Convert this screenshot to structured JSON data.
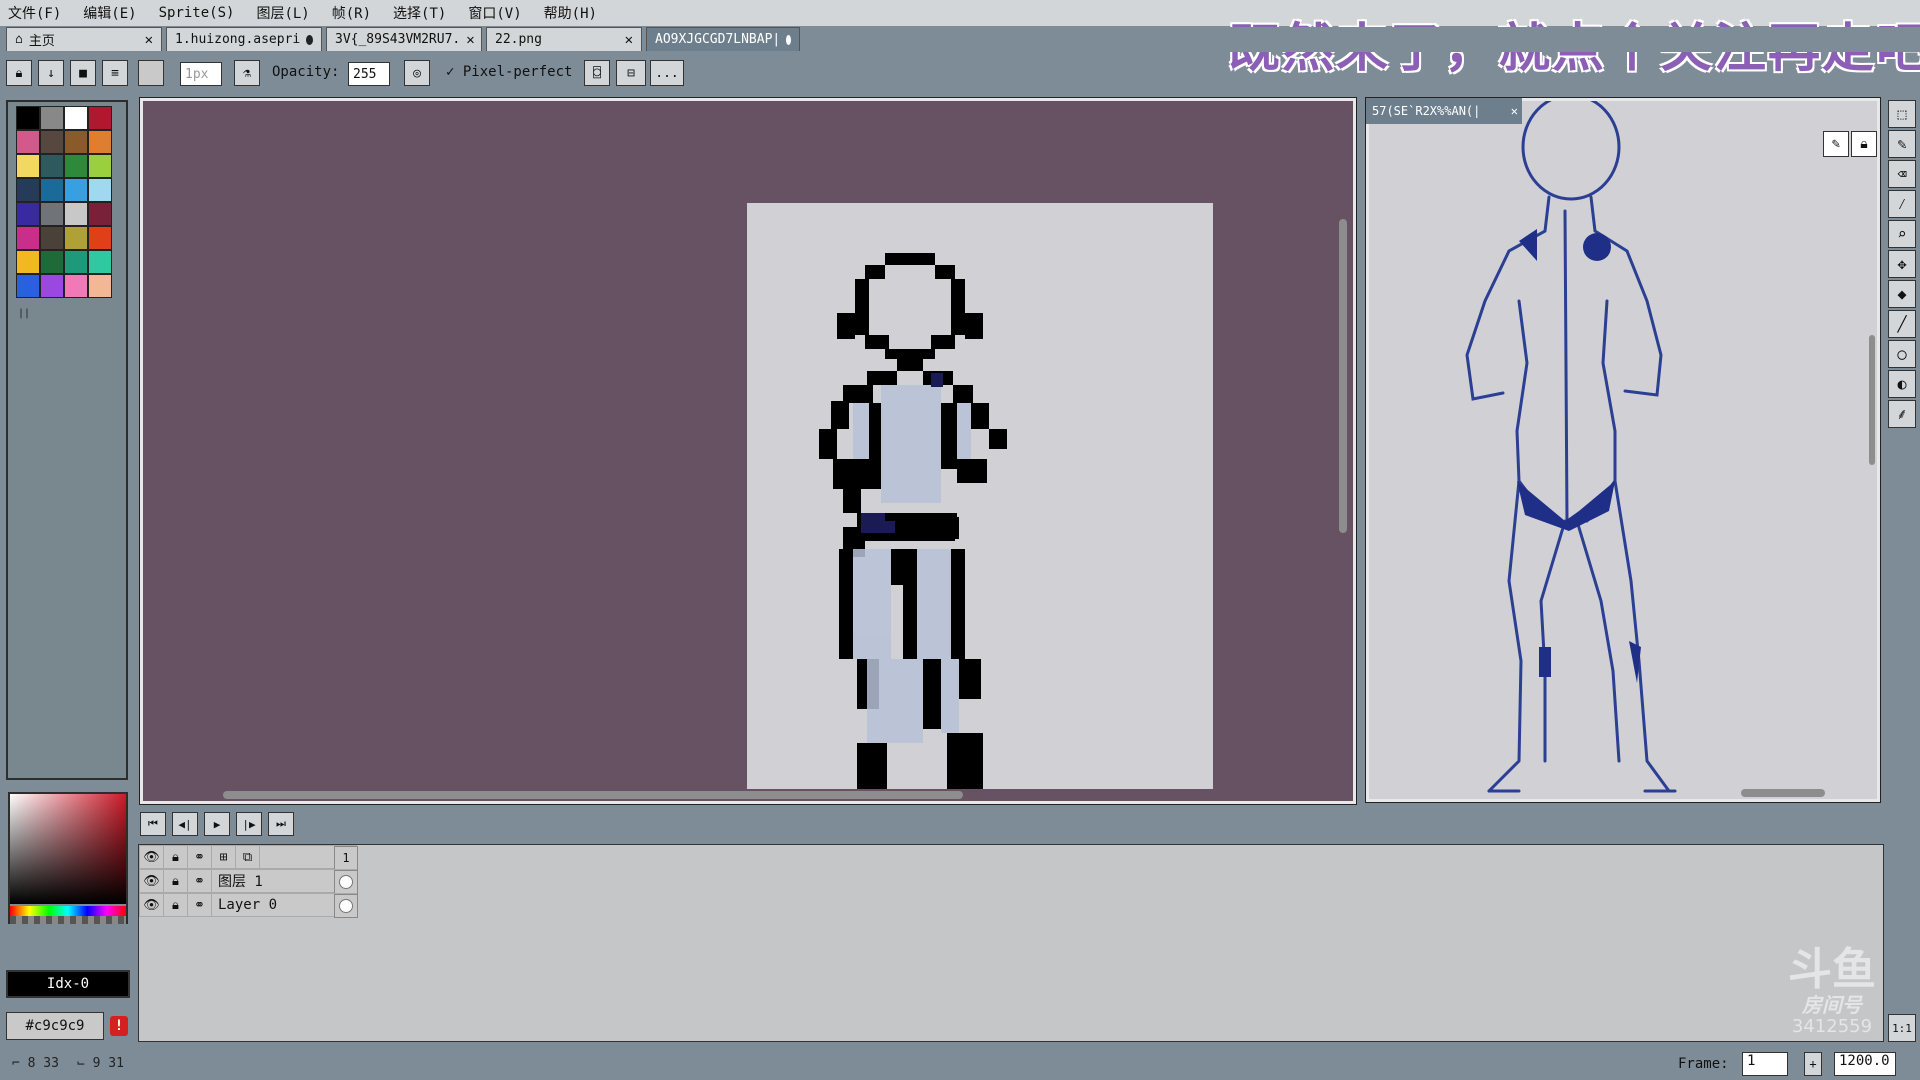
{
  "menu": [
    "文件(F)",
    "编辑(E)",
    "Sprite(S)",
    "图层(L)",
    "帧(R)",
    "选择(T)",
    "窗口(V)",
    "帮助(H)"
  ],
  "promo_text": "既然来了，就点个关注再走吧！",
  "tabs": [
    {
      "label": "主页",
      "state": "close"
    },
    {
      "label": "1.huizong.asepri",
      "state": "dirty"
    },
    {
      "label": "3V{_89S43VM2RU7.",
      "state": "close"
    },
    {
      "label": "22.png",
      "state": "close"
    },
    {
      "label": "AO9XJGCGD7LNBAP|",
      "state": "dirty",
      "active": true
    }
  ],
  "toolbar": {
    "brush_size": "1px",
    "opacity_label": "Opacity:",
    "opacity_value": "255",
    "pixel_perfect_label": "Pixel-perfect",
    "more_label": "..."
  },
  "palette": [
    "#000000",
    "#888888",
    "#ffffff",
    "#b01830",
    "#d25a8a",
    "#56483e",
    "#8a5a2a",
    "#e07e30",
    "#f2d860",
    "#2e5a5e",
    "#2e8a3a",
    "#9ad040",
    "#263a5a",
    "#1a6a9a",
    "#38a0e0",
    "#a0d8f0",
    "#3a2aa0",
    "#707478",
    "#c8c8c8",
    "#7a2038",
    "#c82e8a",
    "#4a4238",
    "#b0a038",
    "#e04018",
    "#f2b820",
    "#1e6a38",
    "#1e9a7a",
    "#30c8a0",
    "#2860e0",
    "#9a48e0",
    "#f07ab8",
    "#f2b896"
  ],
  "color_index": "Idx-0",
  "color_hex": "#c9c9c9",
  "preview_tab_label": "57(SE`R2X%%AN(|",
  "layers": [
    {
      "name": "图层 1",
      "has_link": true
    },
    {
      "name": "Layer 0",
      "has_link": false
    }
  ],
  "frame_header": "1",
  "status": {
    "cursor_a": "8 33",
    "cursor_b": "9 31",
    "frame_label": "Frame:",
    "frame_value": "1",
    "zoom_value": "1200.0"
  },
  "watermark": {
    "logo": "斗鱼",
    "sub": "房间号",
    "room": "3412559"
  }
}
